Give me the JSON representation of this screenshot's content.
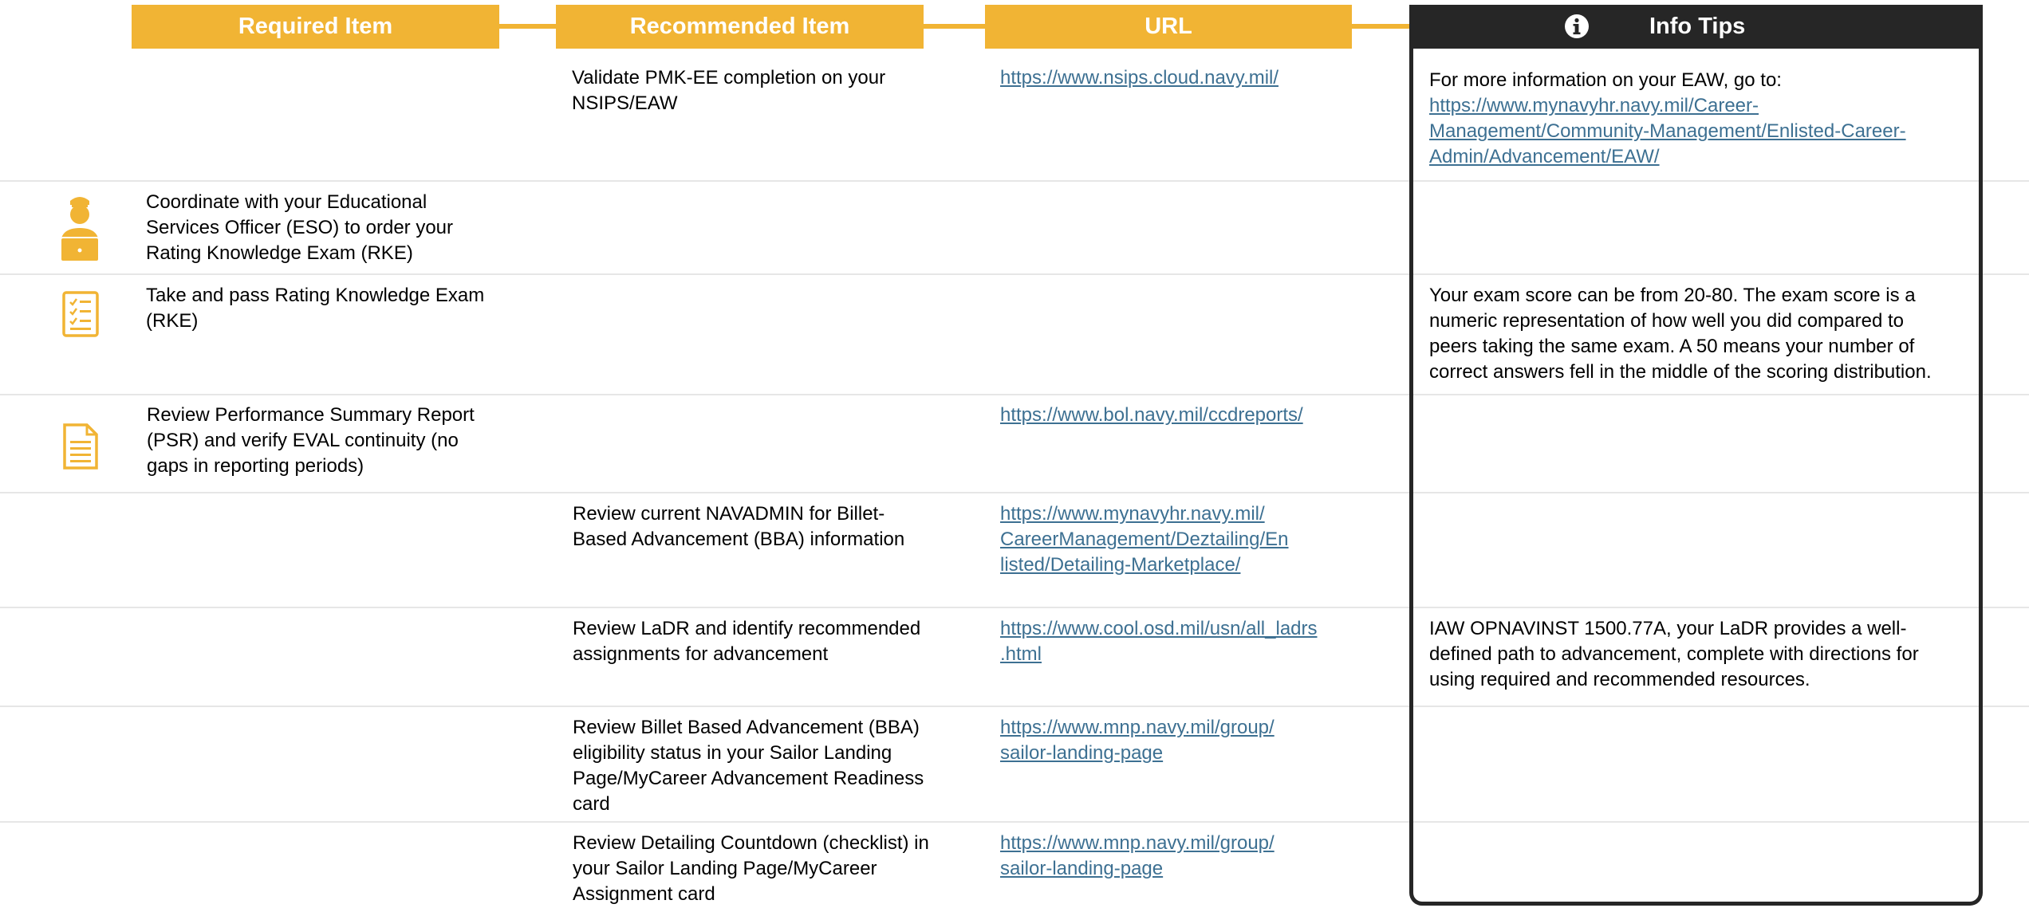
{
  "header": {
    "required_label": "Required Item",
    "recommended_label": "Recommended Item",
    "url_label": "URL",
    "tips_label": "Info Tips",
    "accent_color": "#f1b434",
    "tips_color": "#262626"
  },
  "rows": [
    {
      "required": "",
      "recommended": "Validate PMK-EE completion on your\nNSIPS/EAW",
      "url": "https://www.nsips.cloud.navy.mil/",
      "tip_text": "For more information on your EAW, go to:",
      "tip_link": "https://www.mynavyhr.navy.mil/Career-\nManagement/Community-Management/Enlisted-Career-\nAdmin/Advancement/EAW/"
    },
    {
      "icon": "person-laptop-icon",
      "required": "Coordinate with your Educational\nServices Officer (ESO) to order your\nRating Knowledge Exam (RKE)",
      "recommended": "",
      "url": "",
      "tip_text": ""
    },
    {
      "icon": "checklist-icon",
      "required": "Take and pass Rating Knowledge Exam\n(RKE)",
      "recommended": "",
      "url": "",
      "tip_text": "Your exam score can be from 20-80. The exam score is a\nnumeric representation of how well you did compared to\npeers taking the same exam. A 50 means your number of\ncorrect answers fell in the middle of the scoring distribution."
    },
    {
      "icon": "document-icon",
      "required": "Review Performance Summary Report\n(PSR) and verify EVAL continuity (no\ngaps in reporting periods)",
      "recommended": "",
      "url": "https://www.bol.navy.mil/ccdreports/",
      "tip_text": ""
    },
    {
      "required": "",
      "recommended": "Review current NAVADMIN for Billet-\nBased Advancement (BBA) information",
      "url": "https://www.mynavyhr.navy.mil/\nCareerManagement/Deztailing/En\nlisted/Detailing-Marketplace/",
      "tip_text": ""
    },
    {
      "required": "",
      "recommended": "Review LaDR and identify recommended\nassignments for advancement",
      "url": "https://www.cool.osd.mil/usn/all_ladrs\n.html",
      "tip_text": "IAW OPNAVINST 1500.77A, your LaDR provides a well-\ndefined path to advancement, complete with directions for\nusing required and recommended resources."
    },
    {
      "required": "",
      "recommended": "Review Billet Based Advancement (BBA)\neligibility status in your Sailor Landing\nPage/MyCareer Advancement Readiness\ncard",
      "url": "https://www.mnp.navy.mil/group/\nsailor-landing-page",
      "tip_text": ""
    },
    {
      "required": "",
      "recommended": "Review Detailing Countdown (checklist) in\nyour Sailor Landing Page/MyCareer\nAssignment card",
      "url": "https://www.mnp.navy.mil/group/\nsailor-landing-page",
      "tip_text": ""
    }
  ]
}
